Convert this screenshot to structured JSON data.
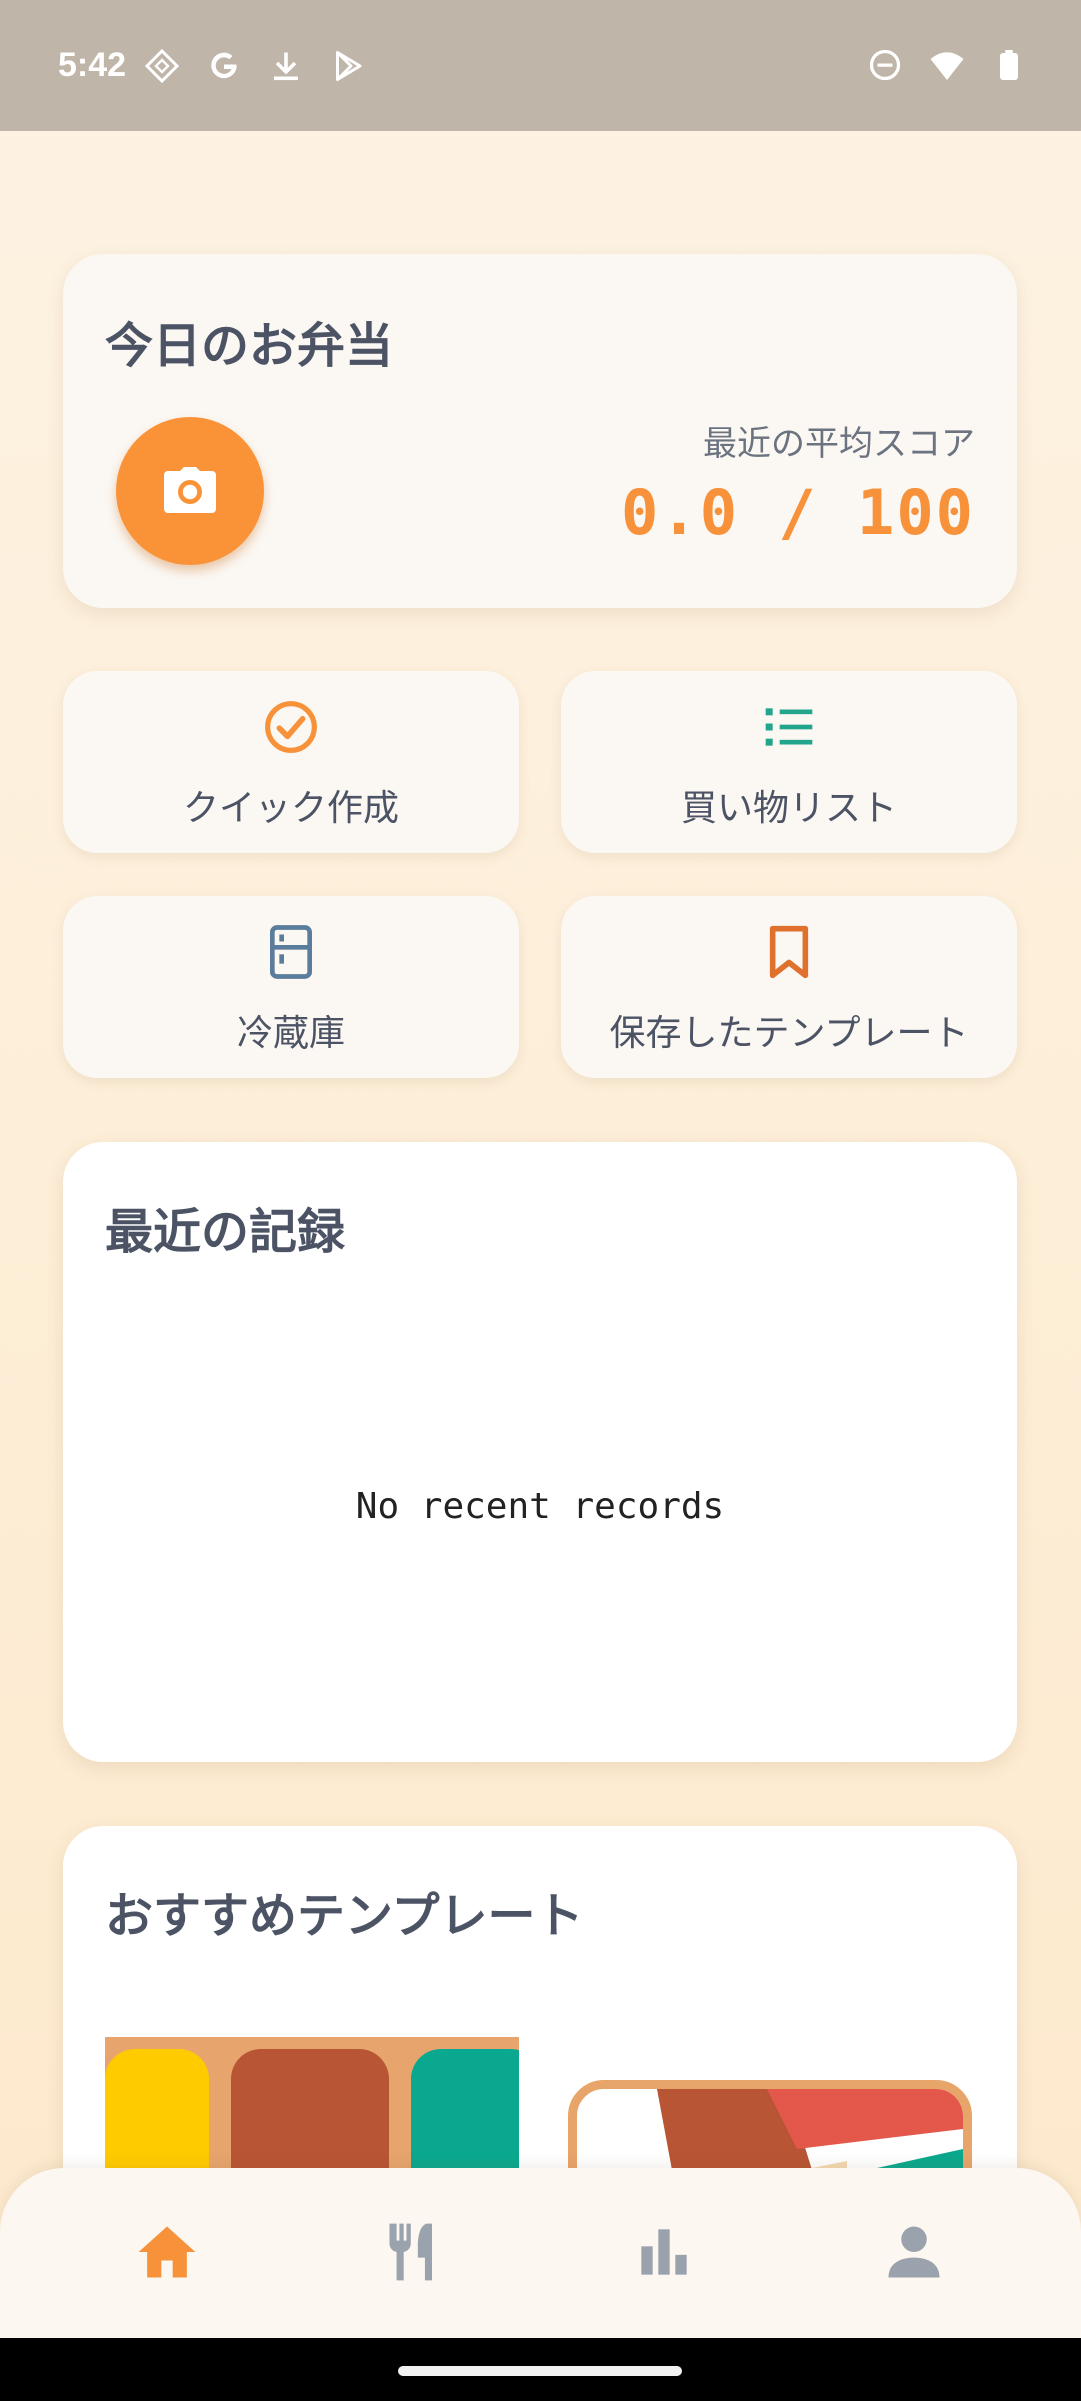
{
  "status_bar": {
    "time": "5:42",
    "left_icons": [
      "screen-record-icon",
      "google-icon",
      "download-icon",
      "play-store-icon"
    ],
    "right_icons": [
      "do-not-disturb-icon",
      "wifi-icon",
      "battery-icon"
    ]
  },
  "today_card": {
    "title": "今日のお弁当",
    "camera_icon": "camera-icon",
    "score_label": "最近の平均スコア",
    "score_value": "0.0 / 100"
  },
  "quick_actions": [
    {
      "label": "クイック作成",
      "icon": "check-circle-icon",
      "color": "#f7913a"
    },
    {
      "label": "買い物リスト",
      "icon": "list-icon",
      "color": "#22a58a"
    },
    {
      "label": "冷蔵庫",
      "icon": "fridge-icon",
      "color": "#5b7d9c"
    },
    {
      "label": "保存したテンプレート",
      "icon": "bookmark-icon",
      "color": "#e0712c"
    }
  ],
  "recent_card": {
    "title": "最近の記録",
    "empty_text": "No recent records"
  },
  "recommend_card": {
    "title": "おすすめテンプレート"
  },
  "bottom_nav": {
    "items": [
      {
        "icon": "home-icon",
        "active": true
      },
      {
        "icon": "utensils-icon",
        "active": false
      },
      {
        "icon": "bar-chart-icon",
        "active": false
      },
      {
        "icon": "person-icon",
        "active": false
      }
    ],
    "active_color": "#f7913a",
    "inactive_color": "#9aa2ad"
  },
  "colors": {
    "accent": "#f7913a",
    "status_bar": "#bfb5a8",
    "background": "#fdf3e3"
  }
}
